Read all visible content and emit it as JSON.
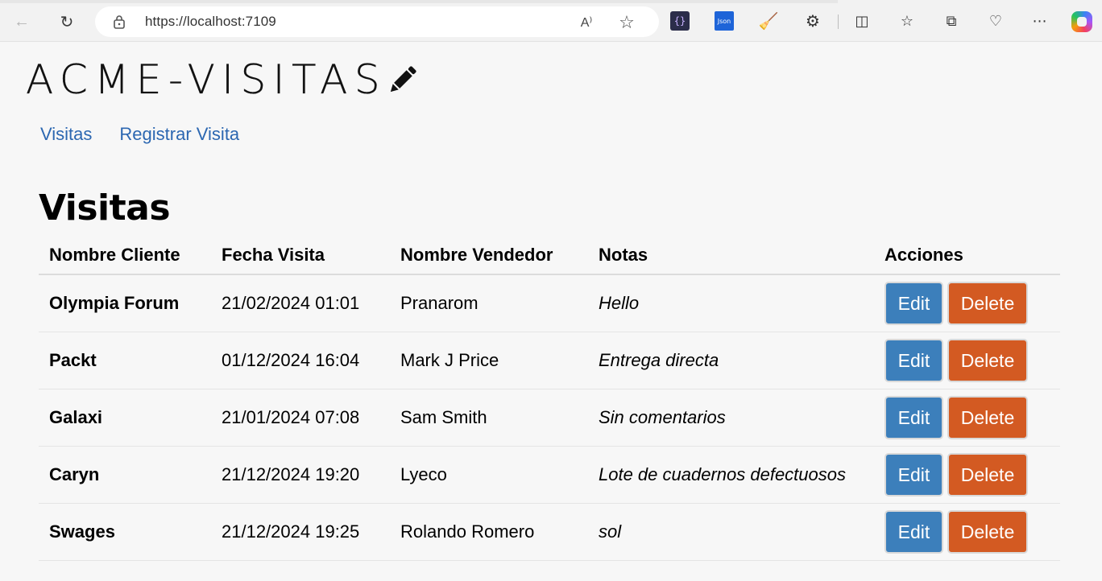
{
  "browser": {
    "url": "https://localhost:7109",
    "icons": [
      "back-icon",
      "refresh-icon",
      "lock-icon",
      "read-aloud-icon",
      "favorite-star-icon",
      "json-brackets-extension-icon",
      "json-extension-icon",
      "broom-extension-icon",
      "extensions-puzzle-icon",
      "split-screen-icon",
      "favorites-icon",
      "collections-icon",
      "browser-essentials-icon",
      "more-icon",
      "copilot-icon"
    ],
    "json_ext_label": "Json"
  },
  "brand": {
    "name": "ACME-VISITAS",
    "icon": "pencil-icon"
  },
  "nav": {
    "visitas": "Visitas",
    "registrar": "Registrar Visita"
  },
  "page": {
    "title": "Visitas"
  },
  "table": {
    "headers": {
      "client": "Nombre Cliente",
      "date": "Fecha Visita",
      "vendor": "Nombre Vendedor",
      "notes": "Notas",
      "actions": "Acciones"
    },
    "rows": [
      {
        "client": "Olympia Forum",
        "date": "21/02/2024 01:01",
        "vendor": "Pranarom",
        "notes": "Hello"
      },
      {
        "client": "Packt",
        "date": "01/12/2024 16:04",
        "vendor": "Mark J Price",
        "notes": "Entrega directa"
      },
      {
        "client": "Galaxi",
        "date": "21/01/2024 07:08",
        "vendor": "Sam Smith",
        "notes": "Sin comentarios"
      },
      {
        "client": "Caryn",
        "date": "21/12/2024 19:20",
        "vendor": "Lyeco",
        "notes": "Lote de cuadernos defectuosos"
      },
      {
        "client": "Swages",
        "date": "21/12/2024 19:25",
        "vendor": "Rolando Romero",
        "notes": "sol"
      }
    ],
    "edit_label": "Edit",
    "delete_label": "Delete"
  },
  "colors": {
    "link": "#2c67b1",
    "edit_button": "#3c7fbb",
    "delete_button": "#d35a22",
    "page_background": "#f7f7f7"
  }
}
